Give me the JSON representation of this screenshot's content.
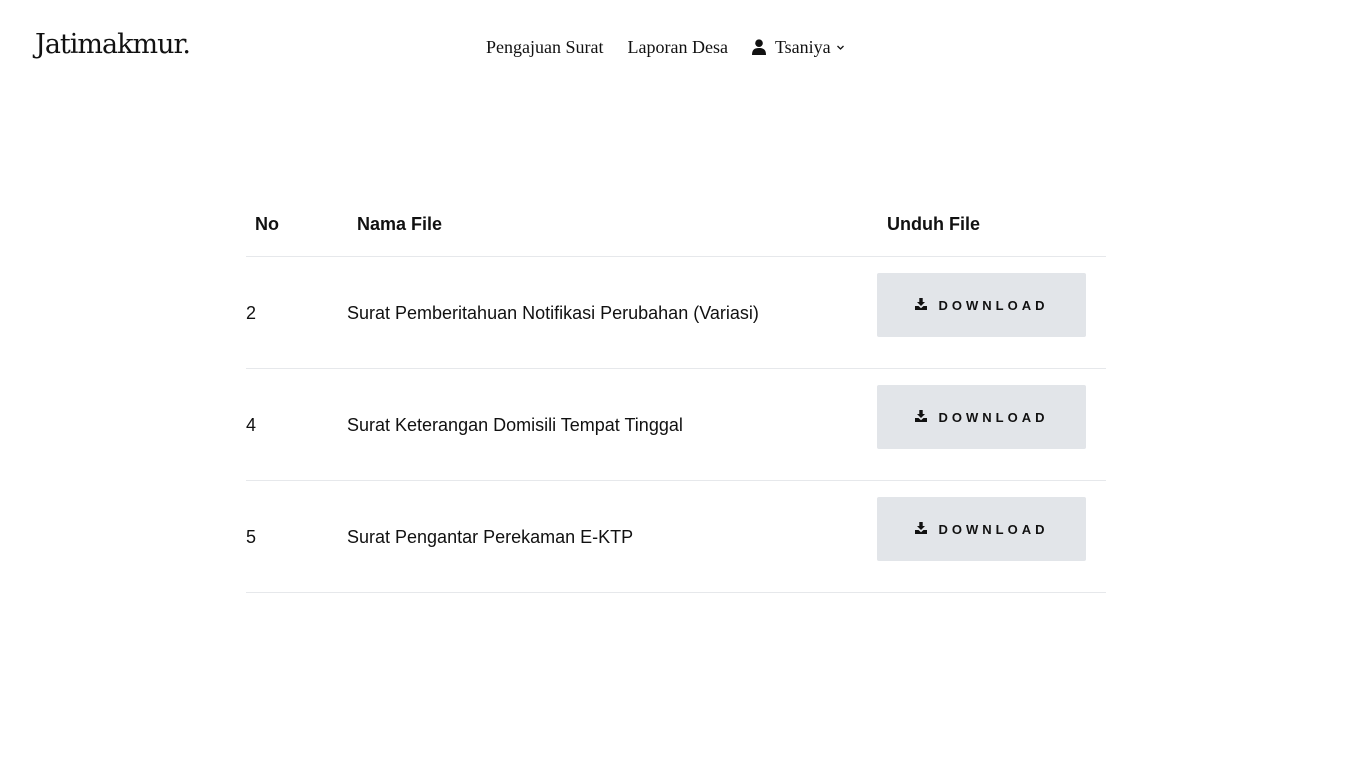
{
  "brand": {
    "name": "Jatimakmur."
  },
  "nav": {
    "items": [
      {
        "label": "Pengajuan Surat"
      },
      {
        "label": "Laporan Desa"
      }
    ],
    "user": {
      "name": "Tsaniya",
      "icon": "user-icon",
      "dropdown_icon": "chevron-down-icon"
    }
  },
  "table": {
    "headers": {
      "no": "No",
      "name": "Nama File",
      "download": "Unduh File"
    },
    "rows": [
      {
        "no": "2",
        "name": "Surat Pemberitahuan Notifikasi Perubahan (Variasi)",
        "action": "DOWNLOAD"
      },
      {
        "no": "4",
        "name": "Surat Keterangan Domisili Tempat Tinggal",
        "action": "DOWNLOAD"
      },
      {
        "no": "5",
        "name": "Surat Pengantar Perekaman E-KTP",
        "action": "DOWNLOAD"
      }
    ],
    "download_icon": "download-icon"
  },
  "colors": {
    "background": "#ffffff",
    "text": "#111111",
    "button_bg": "#e2e5e9",
    "divider": "#e6e8eb"
  }
}
